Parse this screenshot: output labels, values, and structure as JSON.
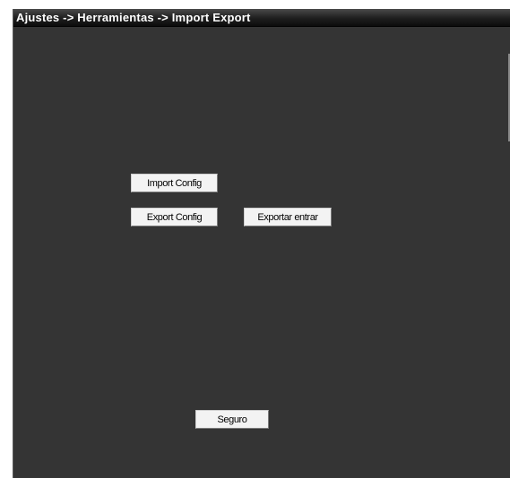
{
  "header": {
    "breadcrumb": "Ajustes -> Herramientas -> Import Export"
  },
  "actions": {
    "import_config": "Import Config",
    "export_config": "Export Config",
    "exportar_entrar": "Exportar entrar",
    "seguro": "Seguro"
  },
  "colors": {
    "panel_background": "#343434",
    "titlebar_background": "#1e1e1e",
    "title_text": "#ffffff",
    "button_background": "#f3f3f3"
  }
}
